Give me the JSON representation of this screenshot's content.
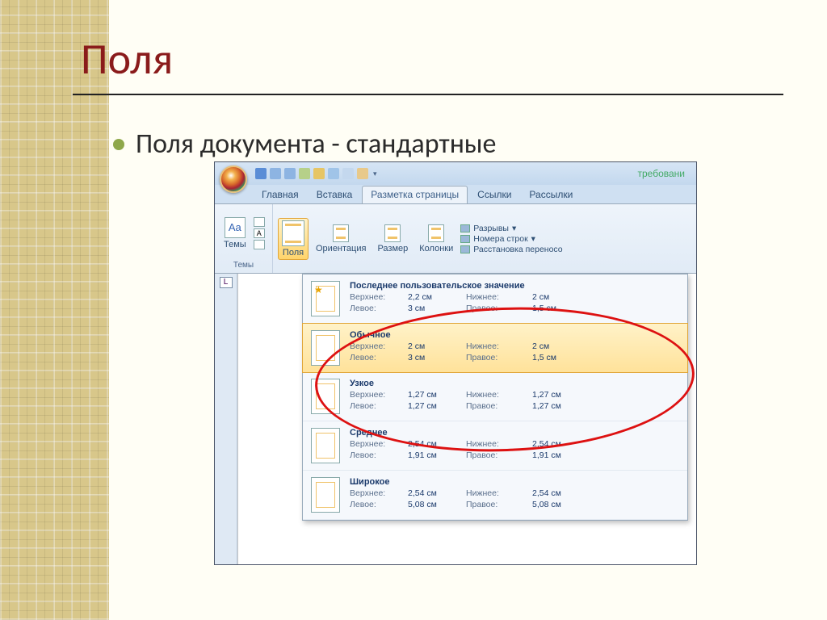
{
  "slide": {
    "title": "Поля",
    "bullet": "Поля документа - стандартные"
  },
  "word": {
    "doc_title": "требовани",
    "qat_icons": [
      "save-icon",
      "undo-icon",
      "redo-icon",
      "quickprint-icon",
      "print-icon",
      "spellcheck-icon",
      "zoom-icon",
      "open-icon"
    ],
    "tabs": [
      "Главная",
      "Вставка",
      "Разметка страницы",
      "Ссылки",
      "Рассылки"
    ],
    "active_tab_index": 2,
    "ribbon": {
      "themes_group": "Темы",
      "themes_btn": "Темы",
      "margins_btn": "Поля",
      "orientation_btn": "Ориентация",
      "size_btn": "Размер",
      "columns_btn": "Колонки",
      "breaks": "Разрывы",
      "line_numbers": "Номера строк",
      "hyphenation": "Расстановка переносо"
    },
    "margins_dropdown": [
      {
        "title": "Последнее пользовательское значение",
        "starred": true,
        "rows": [
          [
            "Верхнее:",
            "2,2 см",
            "Нижнее:",
            "2 см"
          ],
          [
            "Левое:",
            "3 см",
            "Правое:",
            "1,5 см"
          ]
        ]
      },
      {
        "title": "Обычное",
        "hover": true,
        "rows": [
          [
            "Верхнее:",
            "2 см",
            "Нижнее:",
            "2 см"
          ],
          [
            "Левое:",
            "3 см",
            "Правое:",
            "1,5 см"
          ]
        ]
      },
      {
        "title": "Узкое",
        "rows": [
          [
            "Верхнее:",
            "1,27 см",
            "Нижнее:",
            "1,27 см"
          ],
          [
            "Левое:",
            "1,27 см",
            "Правое:",
            "1,27 см"
          ]
        ]
      },
      {
        "title": "Среднее",
        "rows": [
          [
            "Верхнее:",
            "2,54 см",
            "Нижнее:",
            "2,54 см"
          ],
          [
            "Левое:",
            "1,91 см",
            "Правое:",
            "1,91 см"
          ]
        ]
      },
      {
        "title": "Широкое",
        "rows": [
          [
            "Верхнее:",
            "2,54 см",
            "Нижнее:",
            "2,54 см"
          ],
          [
            "Левое:",
            "5,08 см",
            "Правое:",
            "5,08 см"
          ]
        ]
      }
    ]
  }
}
